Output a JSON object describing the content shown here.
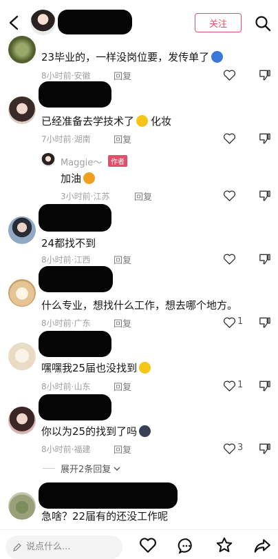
{
  "header": {
    "follow_label": "关注"
  },
  "comments": [
    {
      "text": "23毕业的，一样没岗位要，发传单了",
      "time": "8小时前·安徽",
      "reply": "回复"
    },
    {
      "text": "已经准备去学技术了",
      "text_suffix": "化妆",
      "time": "7小时前·湖南",
      "reply": "回复",
      "sub_reply": {
        "author": "Maggie～",
        "badge": "作者",
        "text": "加油",
        "time": "3小时前·江苏",
        "reply": "回复"
      }
    },
    {
      "text": "24都找不到",
      "time": "8小时前·江西",
      "reply": "回复"
    },
    {
      "text": "什么专业，想找什么工作，想去哪个地方。",
      "time": "8小时前·广东",
      "reply": "回复",
      "likes": "1"
    },
    {
      "text": "嘿嘿我25届也没找到",
      "time": "8小时前·山东",
      "reply": "回复",
      "likes": "1"
    },
    {
      "text": "你以为25的找到了吗",
      "time": "8小时前·福建",
      "reply": "回复",
      "likes": "3",
      "expand": "展开2条回复"
    },
    {
      "text": "急啥？22届有的还没工作呢"
    }
  ],
  "bottom": {
    "input_placeholder": "说点什么..."
  },
  "colors": {
    "accent": "#e0506a",
    "meta": "#a0a0a0"
  }
}
